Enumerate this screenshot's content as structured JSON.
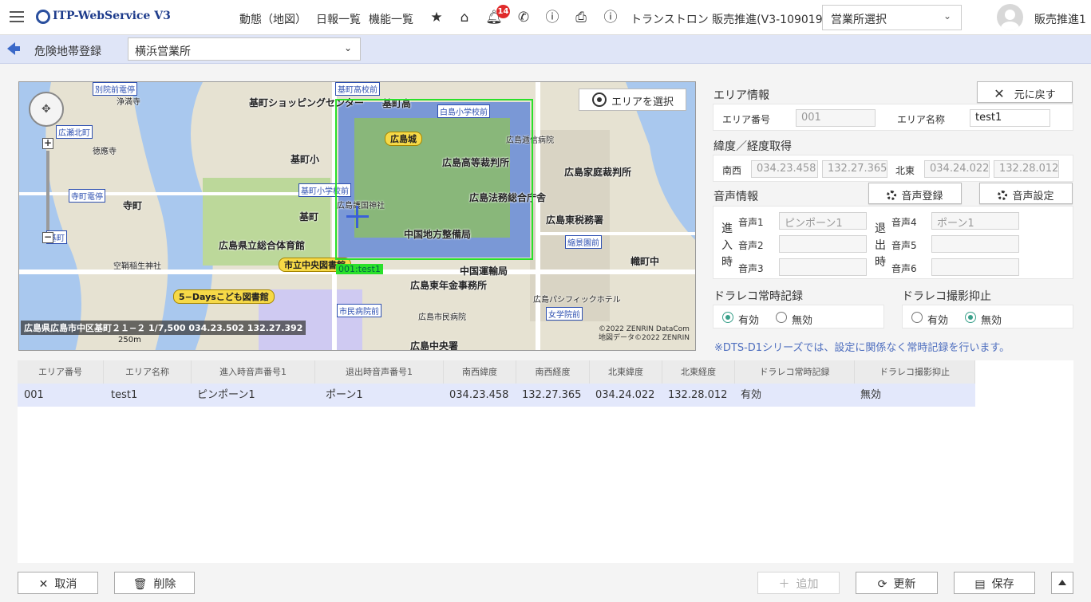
{
  "app": {
    "logo_text": "ITP-WebService V3",
    "nav_links": [
      "動態（地図）",
      "日報一覧",
      "機能一覧"
    ],
    "notification_count": "14",
    "company_name": "トランストロン 販売推進(V3-109019)",
    "office_select_value": "営業所選択",
    "user_name": "販売推進1"
  },
  "subbar": {
    "title": "危険地帯登録",
    "branch": "横浜営業所"
  },
  "map": {
    "select_area_label": "エリアを選択",
    "area_tag": "001:test1",
    "status_text": "広島県広島市中区基町２１−２ 1/7,500 034.23.502 132.27.392",
    "scale_text": "250m",
    "copyright_1": "©2022 ZENRIN DataCom",
    "copyright_2": "地図データ©2022 ZENRIN",
    "labels": {
      "kitamachi_center": "基町ショッピングセンター",
      "kitamachi_high": "基町高",
      "hiroshima_castle": "広島城",
      "hakushima": "白島小学校前",
      "kitamachi_sho": "基町小",
      "high_court": "広島高等裁判所",
      "family_court": "広島家庭裁判所",
      "legal_office": "広島法務総合庁舎",
      "gokoku": "広島護国神社",
      "chugoku_bureau": "中国地方整備局",
      "tax_office": "広島東税務署",
      "gym": "広島県立総合体育館",
      "library": "市立中央図書館",
      "kids_library": "5−Daysこども図書館",
      "transport": "中国運輸局",
      "pension": "広島東年金事務所",
      "pacific": "広島パシフィックホテル",
      "city_hospital": "広島市民病院",
      "chuo": "広島中央署",
      "teramachi": "寺町",
      "kitamachi": "基町",
      "tokuoji": "徳應寺",
      "teramachi_stop": "寺町電停",
      "kitamachi_stop": "基町",
      "kitamachi_es_stop": "基町小学校前",
      "kitamachi_hs_stop": "基町高校前",
      "shuku": "縮景園前",
      "jogakuin": "女学院前",
      "shimin": "市民病院前",
      "hirose": "広瀬北町",
      "yokogawa": "別院前電停",
      "jomanji": "浄満寺",
      "teishin": "広島逓信病院",
      "koku": "空鞘稲生神社",
      "takeda": "幟町中"
    }
  },
  "panel": {
    "area_info_title": "エリア情報",
    "revert_label": "元に戻す",
    "area_no_label": "エリア番号",
    "area_no_value": "001",
    "area_name_label": "エリア名称",
    "area_name_value": "test1",
    "latlng_title": "緯度／経度取得",
    "southwest_label": "南西",
    "sw_lat": "034.23.458",
    "sw_lng": "132.27.365",
    "northeast_label": "北東",
    "ne_lat": "034.24.022",
    "ne_lng": "132.28.012",
    "voice_title": "音声情報",
    "voice_register_label": "音声登録",
    "voice_settings_label": "音声設定",
    "enter_chars": [
      "進",
      "入",
      "時"
    ],
    "exit_chars": [
      "退",
      "出",
      "時"
    ],
    "voice_labels": [
      "音声1",
      "音声2",
      "音声3",
      "音声4",
      "音声5",
      "音声6"
    ],
    "voice_values": [
      "ピンポーン1",
      "",
      "",
      "ポーン1",
      "",
      ""
    ],
    "dashcam_record_title": "ドラレコ常時記録",
    "dashcam_suppress_title": "ドラレコ撮影抑止",
    "enabled_label": "有効",
    "disabled_label": "無効",
    "record_enabled": true,
    "suppress_enabled": false,
    "note": "※DTS-D1シリーズでは、設定に関係なく常時記録を行います。"
  },
  "grid": {
    "headers": [
      "エリア番号",
      "エリア名称",
      "進入時音声番号1",
      "退出時音声番号1",
      "南西緯度",
      "南西経度",
      "北東緯度",
      "北東経度",
      "ドラレコ常時記録",
      "ドラレコ撮影抑止"
    ],
    "rows": [
      [
        "001",
        "test1",
        "ピンポーン1",
        "ポーン1",
        "034.23.458",
        "132.27.365",
        "034.24.022",
        "132.28.012",
        "有効",
        "無効"
      ]
    ]
  },
  "footer": {
    "cancel_label": "取消",
    "delete_label": "削除",
    "add_label": "追加",
    "refresh_label": "更新",
    "save_label": "保存"
  }
}
